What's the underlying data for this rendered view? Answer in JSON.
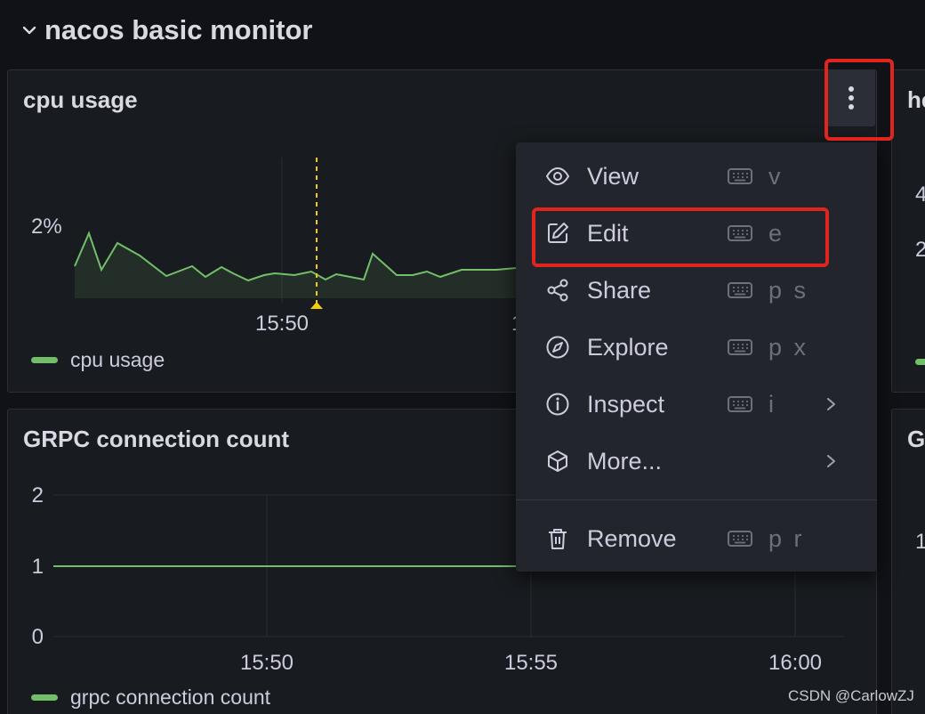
{
  "row": {
    "title": "nacos basic monitor"
  },
  "cpu_panel": {
    "title": "cpu usage",
    "y_tick": "2%",
    "x_tick": "15:50",
    "x_tick_partial": "1",
    "legend": "cpu usage",
    "line_color": "#73bf69",
    "annotation_color": "#f2cc0c"
  },
  "grpc_panel": {
    "title": "GRPC connection count",
    "y_ticks": [
      "2",
      "1",
      "0"
    ],
    "x_ticks": [
      "15:50",
      "15:55",
      "16:00"
    ],
    "legend": "grpc connection count"
  },
  "right_panels": {
    "title_top": "he",
    "ticks_top": [
      "4",
      "2"
    ],
    "title_bottom": "G",
    "tick_bottom": "1"
  },
  "context_menu": {
    "items": [
      {
        "label": "View",
        "icon": "eye-icon",
        "shortcut": "v",
        "submenu": false
      },
      {
        "label": "Edit",
        "icon": "edit-icon",
        "shortcut": "e",
        "submenu": false
      },
      {
        "label": "Share",
        "icon": "share-icon",
        "shortcut": "p s",
        "submenu": false
      },
      {
        "label": "Explore",
        "icon": "compass-icon",
        "shortcut": "p x",
        "submenu": false
      },
      {
        "label": "Inspect",
        "icon": "info-icon",
        "shortcut": "i",
        "submenu": true
      },
      {
        "label": "More...",
        "icon": "cube-icon",
        "shortcut": "",
        "submenu": true
      }
    ],
    "remove": {
      "label": "Remove",
      "icon": "trash-icon",
      "shortcut": "p r"
    }
  },
  "highlight_color": "#e0251e",
  "watermark": "CSDN @CarlowZJ"
}
